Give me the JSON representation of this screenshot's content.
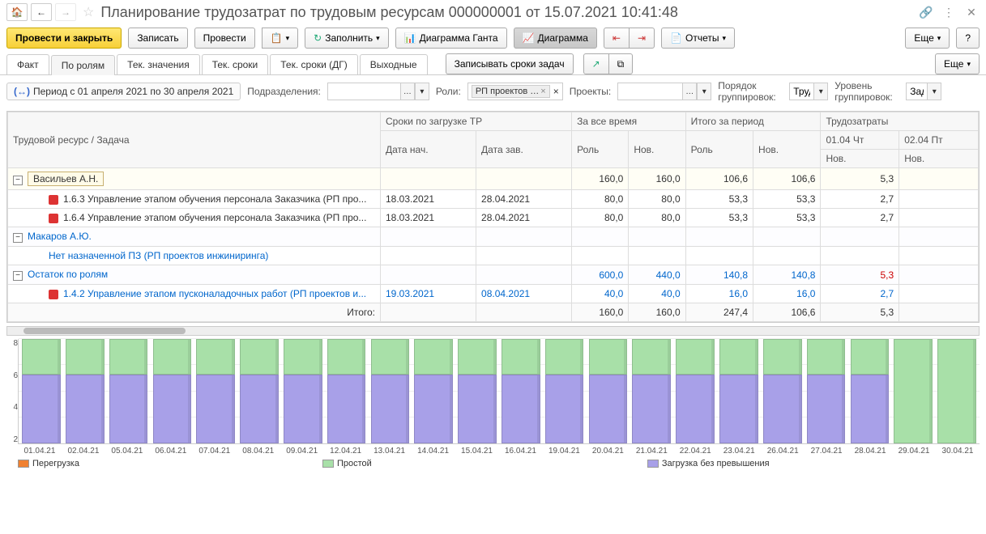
{
  "title": "Планирование трудозатрат по трудовым ресурсам 000000001 от 15.07.2021 10:41:48",
  "toolbar": {
    "post_close": "Провести и закрыть",
    "save": "Записать",
    "post": "Провести",
    "fill": "Заполнить",
    "gantt": "Диаграмма Ганта",
    "chart": "Диаграмма",
    "reports": "Отчеты",
    "more": "Еще"
  },
  "tabs": {
    "fact": "Факт",
    "by_roles": "По ролям",
    "cur_values": "Тек. значения",
    "cur_dates": "Тек. сроки",
    "cur_dates_dg": "Тек. сроки (ДГ)",
    "weekends": "Выходные",
    "write_dates": "Записывать сроки задач",
    "more2": "Еще"
  },
  "filters": {
    "period_label": "Период с 01 апреля 2021 по 30 апреля 2021",
    "dept_label": "Подразделения:",
    "roles_label": "Роли:",
    "role_tag": "РП проектов …",
    "projects_label": "Проекты:",
    "group_order_label": "Порядок группировок:",
    "group_order_value": "Труд",
    "group_level_label": "Уровень группировок:",
    "group_level_value": "Зад"
  },
  "grid": {
    "headers": {
      "resource": "Трудовой ресурс / Задача",
      "load_dates": "Сроки по загрузке ТР",
      "start": "Дата нач.",
      "end": "Дата зав.",
      "all_time": "За все время",
      "role": "Роль",
      "new": "Нов.",
      "period_total": "Итого за период",
      "labor": "Трудозатраты",
      "day1": "01.04 Чт",
      "day2": "02.04 Пт"
    },
    "groups": [
      {
        "name": "Васильев А.Н.",
        "all_role": "160,0",
        "all_new": "160,0",
        "p_role": "106,6",
        "p_new": "106,6",
        "d1_new": "5,3",
        "children": [
          {
            "task": "1.6.3 Управление этапом обучения персонала Заказчика (РП про...",
            "start": "18.03.2021",
            "end": "28.04.2021",
            "all_role": "80,0",
            "all_new": "80,0",
            "p_role": "53,3",
            "p_new": "53,3",
            "d1_new": "2,7"
          },
          {
            "task": "1.6.4 Управление этапом обучения персонала Заказчика (РП про...",
            "start": "18.03.2021",
            "end": "28.04.2021",
            "all_role": "80,0",
            "all_new": "80,0",
            "p_role": "53,3",
            "p_new": "53,3",
            "d1_new": "2,7"
          }
        ]
      },
      {
        "name": "Макаров А.Ю.",
        "link": true,
        "children": [
          {
            "task": "Нет назначенной ПЗ (РП проектов инжиниринга)",
            "link": true,
            "noicon": true
          }
        ]
      },
      {
        "name": "Остаток по ролям",
        "link": true,
        "all_role": "600,0",
        "all_new": "440,0",
        "p_role": "140,8",
        "p_new": "140,8",
        "d1_new": "5,3",
        "d1_red": true,
        "children": [
          {
            "task": "1.4.2 Управление этапом пусконаладочных работ (РП проектов и...",
            "link": true,
            "start": "19.03.2021",
            "end": "08.04.2021",
            "all_role": "40,0",
            "all_new": "40,0",
            "p_role": "16,0",
            "p_new": "16,0",
            "d1_new": "2,7"
          }
        ]
      }
    ],
    "totals_label": "Итого:",
    "totals": {
      "all_role": "160,0",
      "all_new": "160,0",
      "p_role": "247,4",
      "p_new": "106,6",
      "d1_new": "5,3"
    }
  },
  "chart_data": {
    "type": "bar",
    "ylim": [
      0,
      8
    ],
    "yticks": [
      2,
      4,
      6,
      8
    ],
    "categories": [
      "01.04.21",
      "02.04.21",
      "05.04.21",
      "06.04.21",
      "07.04.21",
      "08.04.21",
      "09.04.21",
      "12.04.21",
      "13.04.21",
      "14.04.21",
      "15.04.21",
      "16.04.21",
      "19.04.21",
      "20.04.21",
      "21.04.21",
      "22.04.21",
      "23.04.21",
      "26.04.21",
      "27.04.21",
      "28.04.21",
      "29.04.21",
      "30.04.21"
    ],
    "series": [
      {
        "name": "Загрузка без превышения",
        "color": "#a8a0e8",
        "values": [
          5.3,
          5.3,
          5.3,
          5.3,
          5.3,
          5.3,
          5.3,
          5.3,
          5.3,
          5.3,
          5.3,
          5.3,
          5.3,
          5.3,
          5.3,
          5.3,
          5.3,
          5.3,
          5.3,
          5.3,
          0,
          0
        ]
      },
      {
        "name": "Простой",
        "color": "#a8e0a8",
        "values": [
          2.7,
          2.7,
          2.7,
          2.7,
          2.7,
          2.7,
          2.7,
          2.7,
          2.7,
          2.7,
          2.7,
          2.7,
          2.7,
          2.7,
          2.7,
          2.7,
          2.7,
          2.7,
          2.7,
          2.7,
          8,
          8
        ]
      },
      {
        "name": "Перегрузка",
        "color": "#f08030",
        "values": [
          0,
          0,
          0,
          0,
          0,
          0,
          0,
          0,
          0,
          0,
          0,
          0,
          0,
          0,
          0,
          0,
          0,
          0,
          0,
          0,
          0,
          0
        ]
      }
    ],
    "legend": {
      "over": "Перегрузка",
      "idle": "Простой",
      "load": "Загрузка без превышения"
    }
  }
}
